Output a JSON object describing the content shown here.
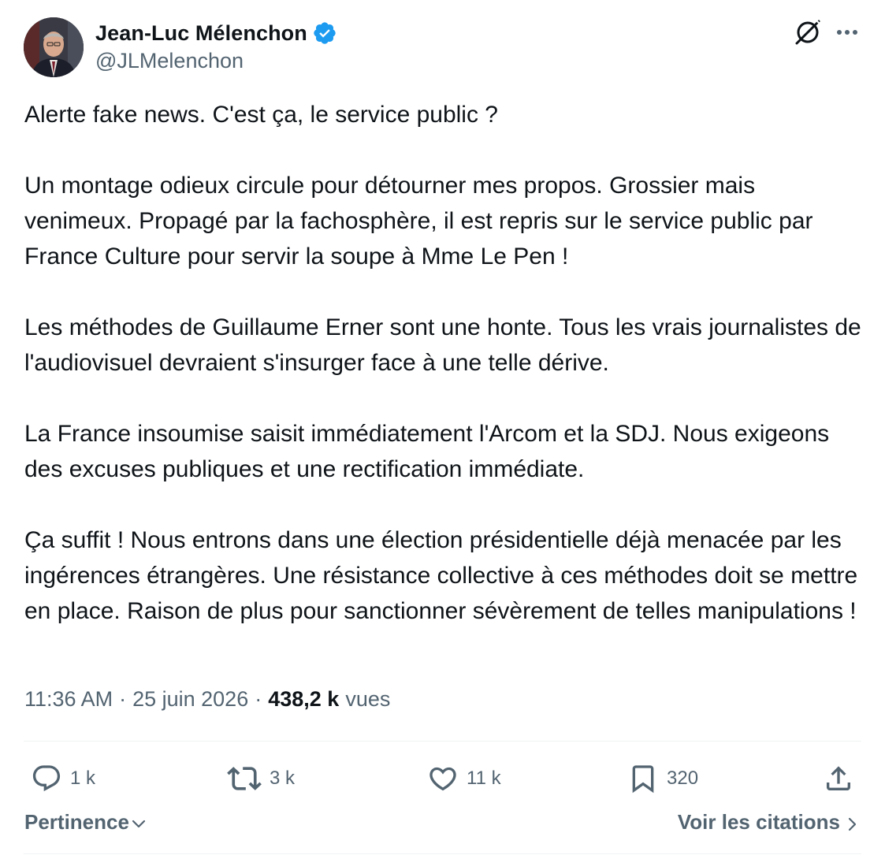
{
  "author": {
    "display_name": "Jean-Luc Mélenchon",
    "handle": "@JLMelenchon",
    "verified": true,
    "avatar_icon": "profile-photo"
  },
  "header_icons": {
    "grok": "grok-icon",
    "more": "more-options-icon"
  },
  "tweet": {
    "paragraphs": [
      "Alerte fake news. C'est ça, le service public ?",
      "Un montage odieux circule pour détourner mes propos. Grossier mais venimeux. Propagé par la fachosphère, il est repris sur le service public par France Culture pour servir la soupe à Mme Le Pen !",
      "Les méthodes de Guillaume Erner sont une honte. Tous les vrais journalistes de l'audiovisuel devraient s'insurger face à une telle dérive.",
      "La France insoumise saisit immédiatement l'Arcom et la SDJ. Nous exigeons des excuses publiques et une rectification immédiate.",
      "Ça suffit ! Nous entrons dans une élection présidentielle déjà menacée par les ingérences étrangères. Une résistance collective à ces méthodes doit se mettre en place. Raison de plus pour sanctionner sévèrement de telles manipulations !"
    ]
  },
  "meta": {
    "time": "11:36 AM",
    "separator": "·",
    "date": "25 juin 2026",
    "views_count": "438,2 k",
    "views_label": "vues"
  },
  "actions": {
    "reply": "1 k",
    "retweet": "3 k",
    "like": "11 k",
    "bookmark": "320"
  },
  "footer": {
    "sort_label": "Pertinence",
    "quotes_label": "Voir les citations"
  },
  "colors": {
    "text": "#0f1419",
    "secondary": "#536471",
    "verified": "#1d9bf0",
    "divider": "#eff3f4"
  }
}
